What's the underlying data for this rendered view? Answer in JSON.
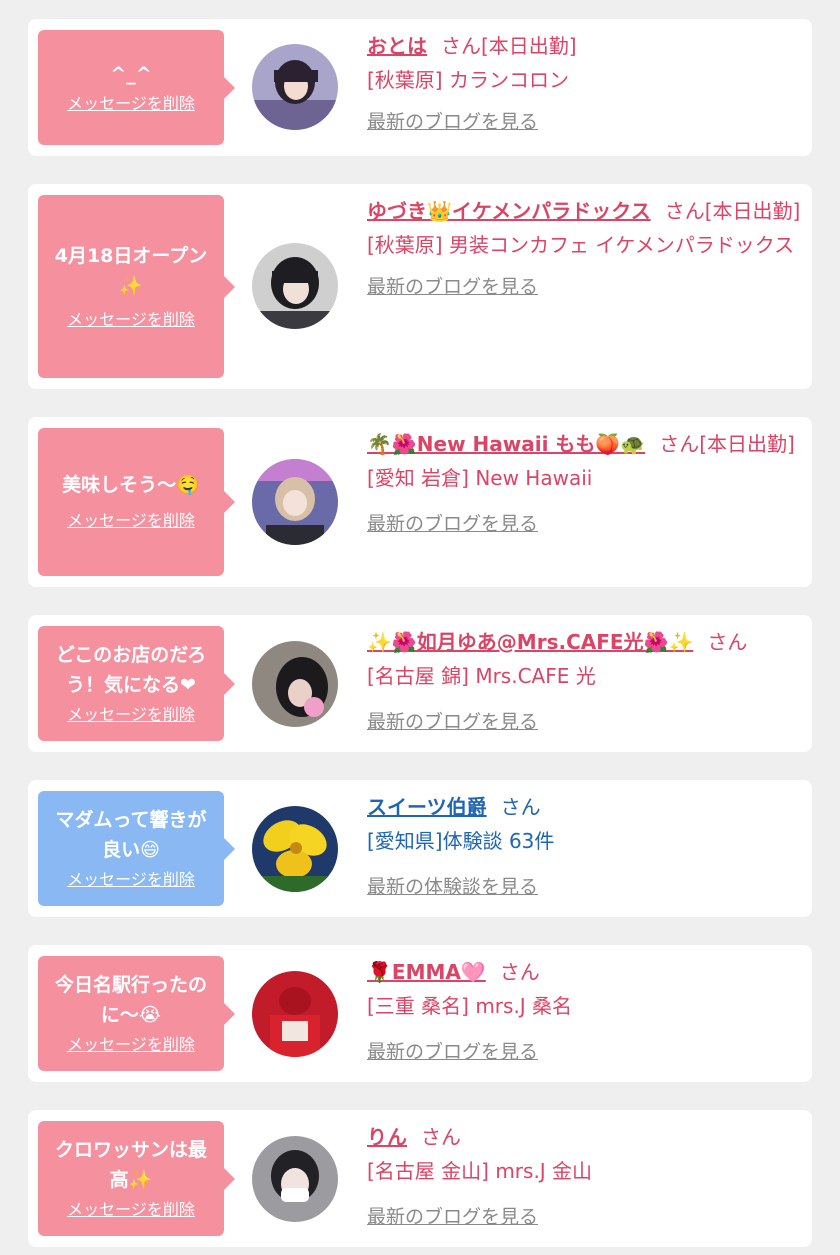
{
  "colors": {
    "page_bg": "#efefef",
    "card_bg": "#ffffff",
    "bubble_pink": "#f5909f",
    "bubble_blue": "#8ab8f2",
    "text_pink": "#dc4465",
    "text_blue": "#1f65b5",
    "link_gray": "#8a8a8a"
  },
  "items": [
    {
      "message": "^_^",
      "delete_label": "メッセージを削除",
      "name": "おとは",
      "suffix": "さん[本日出勤]",
      "shop": "[秋葉原] カランコロン",
      "link_label": "最新のブログを見る"
    },
    {
      "message": "4月18日オープン✨",
      "delete_label": "メッセージを削除",
      "name": "ゆづき👑イケメンパラドックス",
      "suffix": "さん[本日出勤]",
      "shop": "[秋葉原] 男装コンカフェ イケメンパラドックス",
      "link_label": "最新のブログを見る"
    },
    {
      "message": "美味しそう〜🤤",
      "delete_label": "メッセージを削除",
      "name": "🌴🌺New Hawaii もも🍑🐢",
      "suffix": "さん[本日出勤]",
      "shop": "[愛知 岩倉] New Hawaii",
      "link_label": "最新のブログを見る"
    },
    {
      "message": "どこのお店のだろう！気になる❤",
      "delete_label": "メッセージを削除",
      "name": "✨🌺如月ゆあ@Mrs.CAFE光🌺✨",
      "suffix": "さん",
      "shop": "[名古屋 錦] Mrs.CAFE 光",
      "link_label": "最新のブログを見る"
    },
    {
      "message": "マダムって響きが良い😄",
      "delete_label": "メッセージを削除",
      "name": "スイーツ伯爵",
      "suffix": "さん",
      "shop": "[愛知県]体験談 63件",
      "link_label": "最新の体験談を見る"
    },
    {
      "message": "今日名駅行ったのに〜😭",
      "delete_label": "メッセージを削除",
      "name": "🌹EMMA🩷",
      "suffix": "さん",
      "shop": "[三重 桑名] mrs.J 桑名",
      "link_label": "最新のブログを見る"
    },
    {
      "message": "クロワッサンは最高✨",
      "delete_label": "メッセージを削除",
      "name": "りん",
      "suffix": "さん",
      "shop": "[名古屋 金山] mrs.J 金山",
      "link_label": "最新のブログを見る"
    }
  ]
}
